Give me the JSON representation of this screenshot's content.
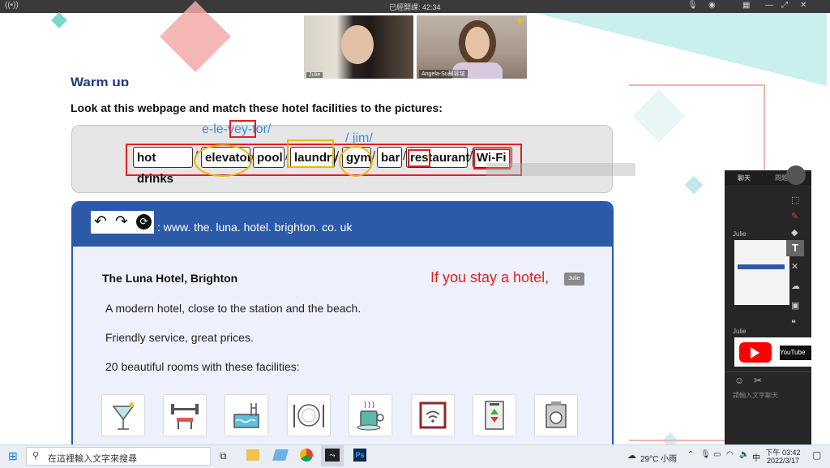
{
  "meeting": {
    "timer_label": "已經開課: 42:34",
    "participants": [
      {
        "name": "Julie"
      },
      {
        "name": "Angela-Su蘇容瑄"
      }
    ]
  },
  "slide": {
    "heading": "Warm up",
    "instruction": "Look at this webpage and match these hotel facilities to the pictures:",
    "words": [
      "hot drinks",
      "elevator",
      "pool",
      "laundry",
      "gym",
      "bar",
      "restaurant",
      "Wi-Fi"
    ],
    "separator": "/",
    "annotations": {
      "elevator_pron": "e-le-vey-tor/",
      "gym_pron": "/ jim/",
      "teacher_note": "If you stay a hotel,",
      "cursor_label": "Julie"
    },
    "browser": {
      "url": ": www. the. luna. hotel. brighton. co. uk"
    },
    "page": {
      "title": "The Luna Hotel, Brighton",
      "line1": "A modern hotel, close to the station and the beach.",
      "line2": "Friendly service, great prices.",
      "line3": "20 beautiful rooms with these facilities:"
    },
    "facility_icons": [
      "cocktail-icon",
      "gym-icon",
      "pool-icon",
      "restaurant-icon",
      "hot-drink-icon",
      "wifi-icon",
      "elevator-icon",
      "laundry-icon"
    ]
  },
  "chat": {
    "tab_chat": "聊天",
    "tab_question": "問題",
    "sender1": "Julie",
    "sender2": "Julie",
    "input_placeholder": "請輸入文字聊天",
    "youtube_label": "YouTube"
  },
  "taskbar": {
    "search_placeholder": "在這裡輸入文字來搜尋",
    "weather": "29°C 小雨",
    "ime": "中",
    "time": "下午 03:42",
    "date": "2022/3/17"
  }
}
